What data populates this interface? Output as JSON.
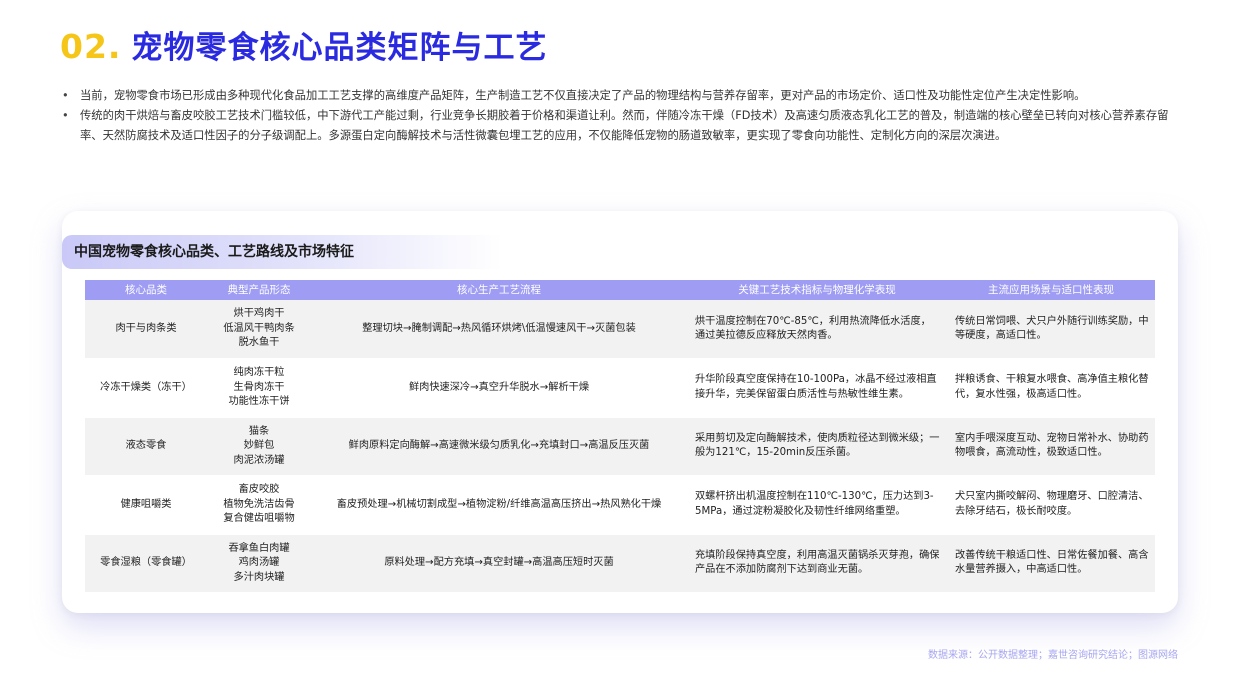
{
  "header": {
    "number": "02.",
    "title": "宠物零食核心品类矩阵与工艺"
  },
  "bullets": [
    "当前，宠物零食市场已形成由多种现代化食品加工工艺支撑的高维度产品矩阵，生产制造工艺不仅直接决定了产品的物理结构与营养存留率，更对产品的市场定价、适口性及功能性定位产生决定性影响。",
    "传统的肉干烘焙与畜皮咬胶工艺技术门槛较低，中下游代工产能过剩，行业竞争长期胶着于价格和渠道让利。然而，伴随冷冻干燥（FD技术）及高速匀质液态乳化工艺的普及，制造端的核心壁垒已转向对核心营养素存留率、天然防腐技术及适口性因子的分子级调配上。多源蛋白定向酶解技术与活性微囊包埋工艺的应用，不仅能降低宠物的肠道致敏率，更实现了零食向功能性、定制化方向的深层次演进。"
  ],
  "card": {
    "title": "中国宠物零食核心品类、工艺路线及市场特征"
  },
  "table": {
    "headers": [
      "核心品类",
      "典型产品形态",
      "核心生产工艺流程",
      "关键工艺技术指标与物理化学表现",
      "主流应用场景与适口性表现"
    ],
    "rows": [
      {
        "category": "肉干与肉条类",
        "products": [
          "烘干鸡肉干",
          "低温风干鸭肉条",
          "脱水鱼干"
        ],
        "process": "整理切块→腌制调配→热风循环烘烤\\低温慢速风干→灭菌包装",
        "tech": "烘干温度控制在70℃-85℃，利用热流降低水活度，通过美拉德反应释放天然肉香。",
        "usage": "传统日常饲喂、犬只户外随行训练奖励，中等硬度，高适口性。"
      },
      {
        "category": "冷冻干燥类（冻干）",
        "products": [
          "纯肉冻干粒",
          "生骨肉冻干",
          "功能性冻干饼"
        ],
        "process": "鲜肉快速深冷→真空升华脱水→解析干燥",
        "tech": "升华阶段真空度保持在10-100Pa，冰晶不经过液相直接升华，完美保留蛋白质活性与热敏性维生素。",
        "usage": "拌粮诱食、干粮复水喂食、高净值主粮化替代，复水性强，极高适口性。"
      },
      {
        "category": "液态零食",
        "products": [
          "猫条",
          "妙鲜包",
          "肉泥浓汤罐"
        ],
        "process": "鲜肉原料定向酶解→高速微米级匀质乳化→充填封口→高温反压灭菌",
        "tech": "采用剪切及定向酶解技术，使肉质粒径达到微米级；一般为121℃，15-20min反压杀菌。",
        "usage": "室内手喂深度互动、宠物日常补水、协助药物喂食，高流动性，极致适口性。"
      },
      {
        "category": "健康咀嚼类",
        "products": [
          "畜皮咬胶",
          "植物免洗洁齿骨",
          "复合健齿咀嚼物"
        ],
        "process": "畜皮预处理→机械切割成型→植物淀粉/纤维高温高压挤出→热风熟化干燥",
        "tech": "双螺杆挤出机温度控制在110℃-130℃，压力达到3-5MPa，通过淀粉凝胶化及韧性纤维网络重塑。",
        "usage": "犬只室内撕咬解闷、物理磨牙、口腔清洁、去除牙结石，极长耐咬度。"
      },
      {
        "category": "零食湿粮（零食罐）",
        "products": [
          "吞拿鱼白肉罐",
          "鸡肉汤罐",
          "多汁肉块罐"
        ],
        "process": "原料处理→配方充填→真空封罐→高温高压短时灭菌",
        "tech": "充填阶段保持真空度，利用高温灭菌锅杀灭芽孢，确保产品在不添加防腐剂下达到商业无菌。",
        "usage": "改善传统干粮适口性、日常佐餐加餐、高含水量营养摄入，中高适口性。"
      }
    ]
  },
  "footer": {
    "source": "数据来源：公开数据整理；嘉世咨询研究结论；图源网络"
  },
  "colors": {
    "number": "#f5c518",
    "title": "#2a2ae0",
    "table_header": "#9f9cf3",
    "row_shade": "#f2f2f2",
    "footer": "#a8a6f0"
  }
}
